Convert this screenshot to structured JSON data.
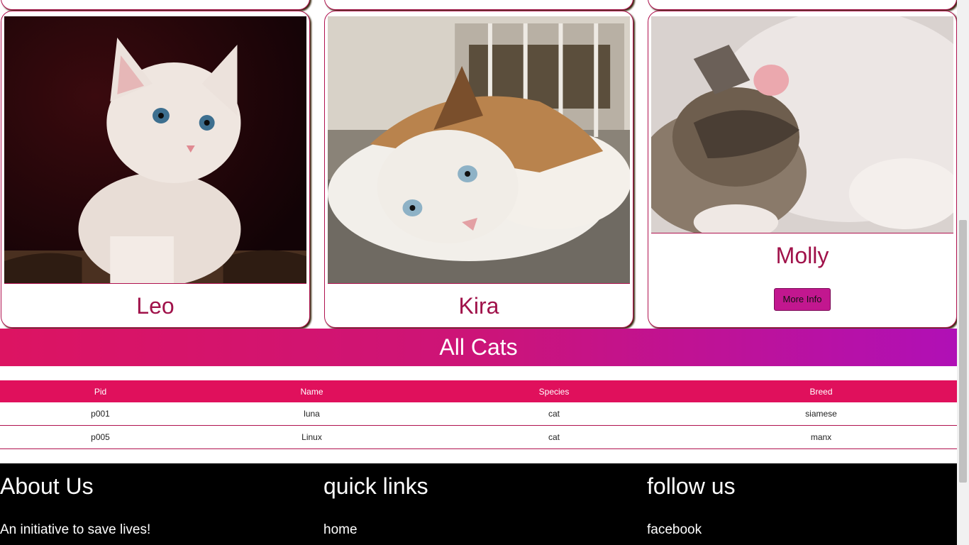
{
  "cards": [
    {
      "name": "Leo"
    },
    {
      "name": "Kira"
    },
    {
      "name": "Molly",
      "button_label": "More Info"
    }
  ],
  "section_title": "All Cats",
  "table": {
    "headers": [
      "Pid",
      "Name",
      "Species",
      "Breed"
    ],
    "rows": [
      [
        "p001",
        "luna",
        "cat",
        "siamese"
      ],
      [
        "p005",
        "Linux",
        "cat",
        "manx"
      ]
    ]
  },
  "footer": {
    "about": {
      "title": "About Us",
      "text": "An initiative to save lives!"
    },
    "links": {
      "title": "quick links",
      "items": [
        "home"
      ]
    },
    "follow": {
      "title": "follow us",
      "items": [
        "facebook"
      ]
    }
  },
  "colors": {
    "accent": "#e0105c",
    "name_text": "#a0124a",
    "gradient_end": "#b010b6",
    "footer_bg": "#000000"
  }
}
